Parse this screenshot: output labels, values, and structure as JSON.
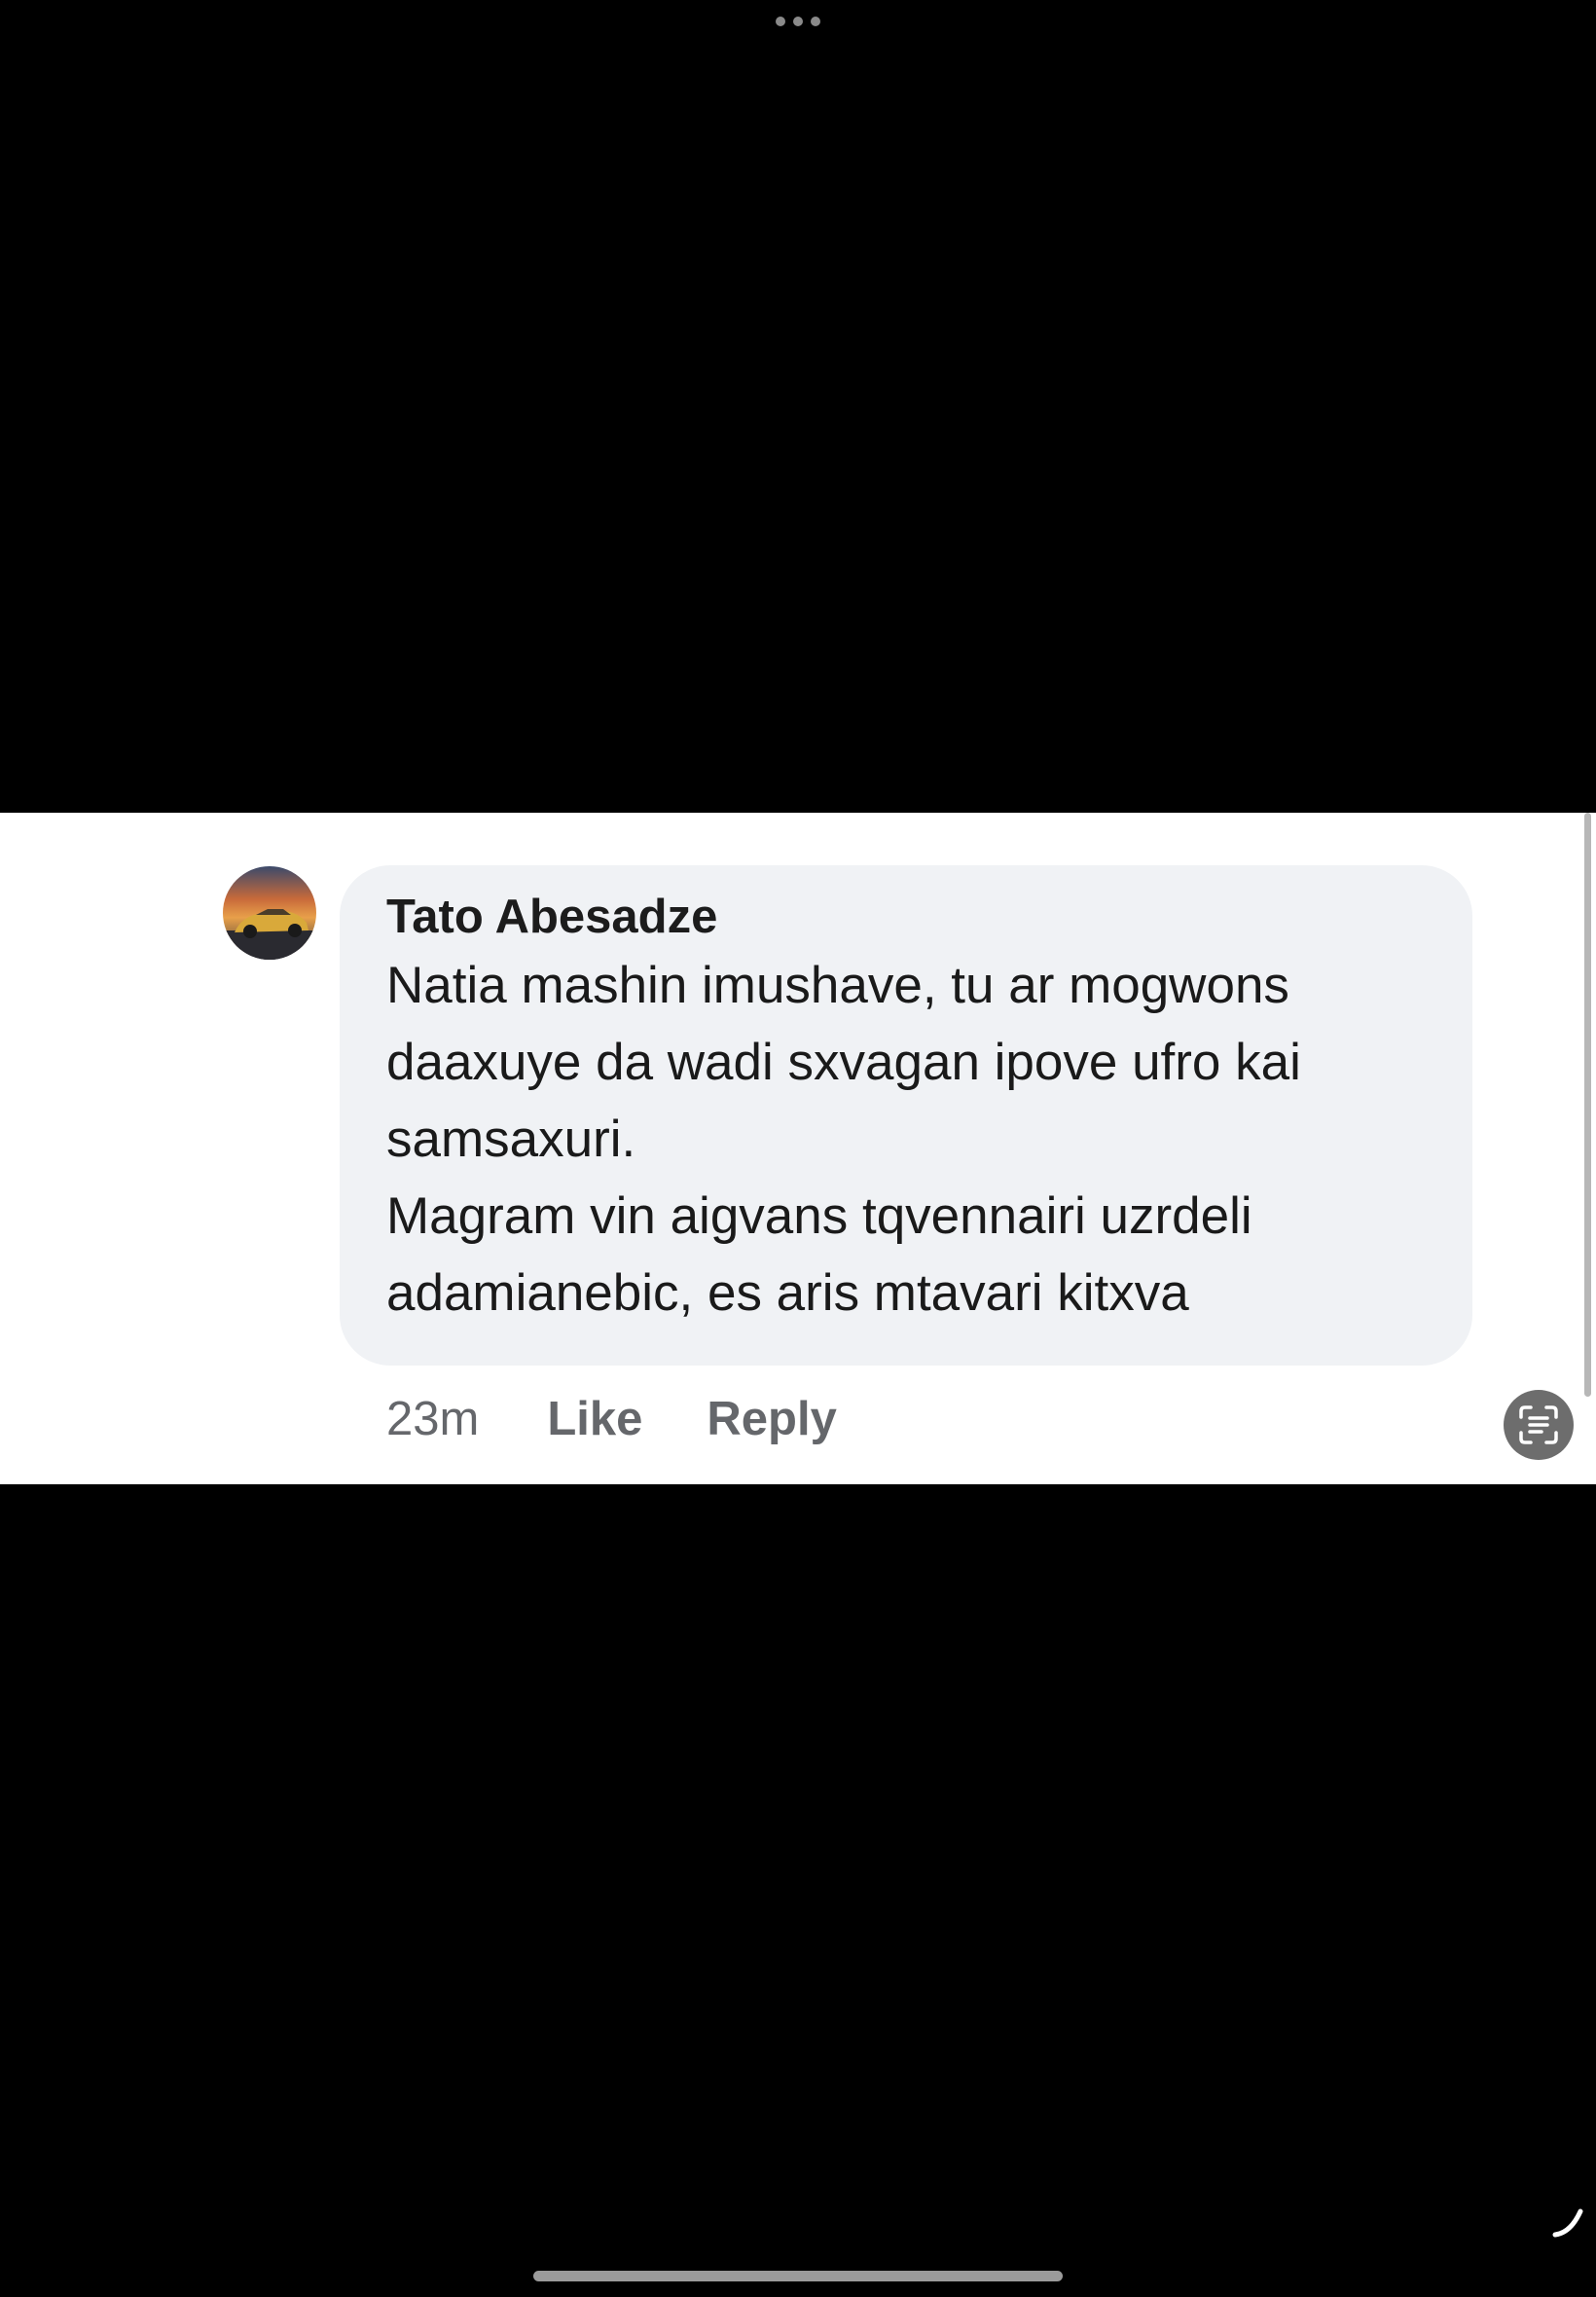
{
  "comment": {
    "author": "Tato Abesadze",
    "text_lines": [
      "Natia mashin imushave, tu ar mogwons",
      "daaxuye da wadi sxvagan ipove ufro kai",
      "samsaxuri.",
      "Magram vin aigvans tqvennairi uzrdeli",
      "adamianebic, es aris mtavari kitxva"
    ],
    "timestamp": "23m",
    "like_label": "Like",
    "reply_label": "Reply",
    "avatar_icon": "avatar-photo-sports-car-sunset"
  },
  "icons": {
    "top_menu": "more-dots-icon",
    "text_scan": "live-text-scan-icon",
    "corner_tool": "markup-pen-handle-icon"
  },
  "colors": {
    "background": "#000000",
    "panel": "#ffffff",
    "bubble": "#f0f2f5",
    "meta_text": "#65676b"
  }
}
